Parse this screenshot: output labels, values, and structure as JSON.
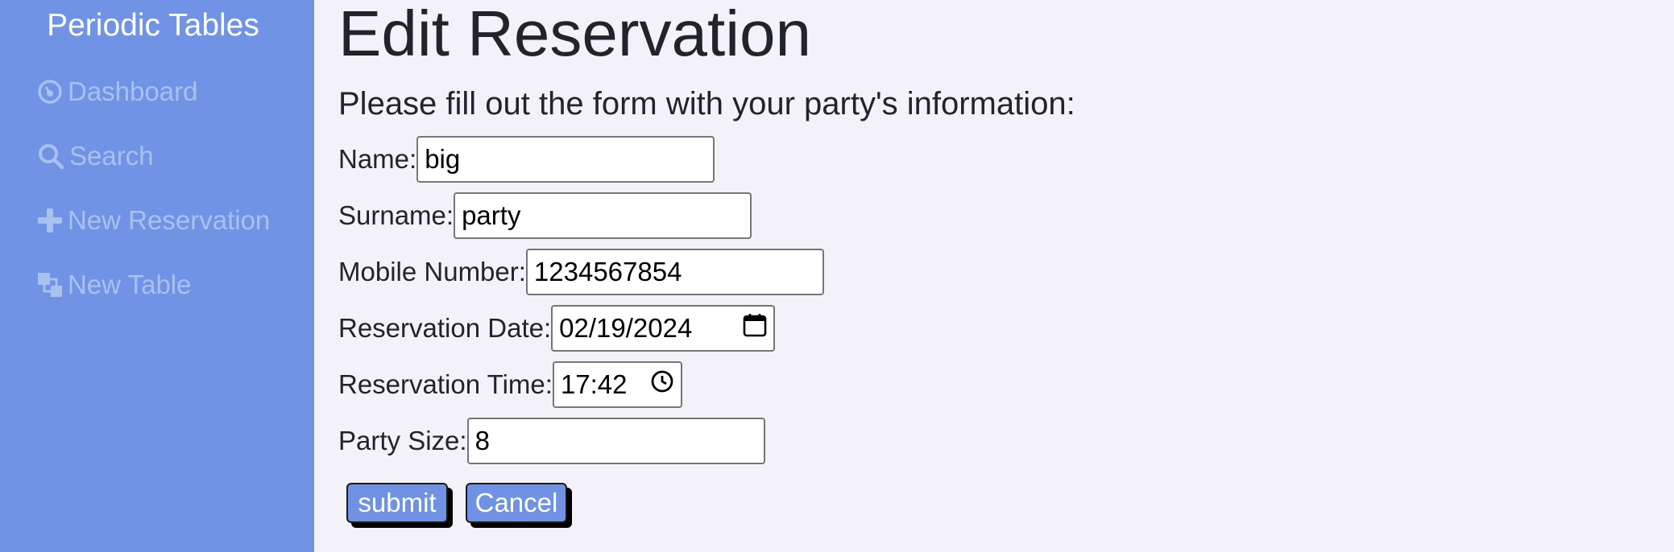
{
  "sidebar": {
    "brand": "Periodic Tables",
    "items": [
      {
        "label": "Dashboard",
        "icon": "dashboard-icon"
      },
      {
        "label": "Search",
        "icon": "search-icon"
      },
      {
        "label": "New Reservation",
        "icon": "plus-icon"
      },
      {
        "label": "New Table",
        "icon": "new-table-icon"
      }
    ]
  },
  "main": {
    "title": "Edit Reservation",
    "subtitle": "Please fill out the form with your party's information:",
    "form": {
      "name": {
        "label": "Name:",
        "value": "big"
      },
      "surname": {
        "label": "Surname:",
        "value": "party"
      },
      "mobile": {
        "label": "Mobile Number:",
        "value": "1234567854"
      },
      "date": {
        "label": "Reservation Date:",
        "value": "02/19/2024"
      },
      "time": {
        "label": "Reservation Time:",
        "value": "17:42"
      },
      "party_size": {
        "label": "Party Size:",
        "value": "8"
      }
    },
    "buttons": {
      "submit": "submit",
      "cancel": "Cancel"
    }
  },
  "colors": {
    "sidebar_bg": "#7093e5",
    "nav_text": "#a9c1ef",
    "page_bg": "#f2f2f8",
    "button_bg": "#6f92e5"
  }
}
